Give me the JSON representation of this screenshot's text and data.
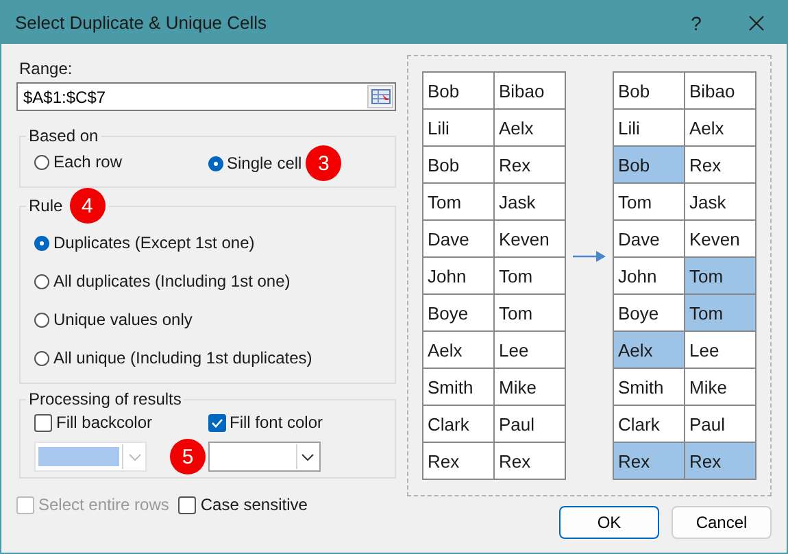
{
  "window": {
    "title": "Select Duplicate & Unique Cells",
    "help": "?"
  },
  "range": {
    "label": "Range:",
    "value": "$A$1:$C$7"
  },
  "based_on": {
    "title": "Based on",
    "badge": "3",
    "options": [
      {
        "label": "Each row",
        "selected": false
      },
      {
        "label": "Single cell",
        "selected": true
      }
    ]
  },
  "rule": {
    "title": "Rule",
    "badge": "4",
    "options": [
      {
        "label": "Duplicates (Except 1st one)",
        "selected": true
      },
      {
        "label": "All duplicates (Including 1st one)",
        "selected": false
      },
      {
        "label": "Unique values only",
        "selected": false
      },
      {
        "label": "All unique (Including 1st duplicates)",
        "selected": false
      }
    ]
  },
  "processing": {
    "title": "Processing of results",
    "badge": "5",
    "options": [
      {
        "label": "Fill backcolor",
        "checked": false,
        "color": "#a8c8f0",
        "disabled": true
      },
      {
        "label": "Fill font color",
        "checked": true,
        "color": "#ffffff",
        "disabled": false
      }
    ]
  },
  "bottom_options": [
    {
      "label": "Select entire rows",
      "checked": false,
      "disabled": true
    },
    {
      "label": "Case sensitive",
      "checked": false,
      "disabled": false
    }
  ],
  "preview": {
    "before": [
      [
        {
          "text": "Bob",
          "highlighted": false
        },
        {
          "text": "Bibao",
          "highlighted": false
        }
      ],
      [
        {
          "text": "Lili",
          "highlighted": false
        },
        {
          "text": "Aelx",
          "highlighted": false
        }
      ],
      [
        {
          "text": "Bob",
          "highlighted": false
        },
        {
          "text": "Rex",
          "highlighted": false
        }
      ],
      [
        {
          "text": "Tom",
          "highlighted": false
        },
        {
          "text": "Jask",
          "highlighted": false
        }
      ],
      [
        {
          "text": "Dave",
          "highlighted": false
        },
        {
          "text": "Keven",
          "highlighted": false
        }
      ],
      [
        {
          "text": "John",
          "highlighted": false
        },
        {
          "text": "Tom",
          "highlighted": false
        }
      ],
      [
        {
          "text": "Boye",
          "highlighted": false
        },
        {
          "text": "Tom",
          "highlighted": false
        }
      ],
      [
        {
          "text": "Aelx",
          "highlighted": false
        },
        {
          "text": "Lee",
          "highlighted": false
        }
      ],
      [
        {
          "text": "Smith",
          "highlighted": false
        },
        {
          "text": "Mike",
          "highlighted": false
        }
      ],
      [
        {
          "text": "Clark",
          "highlighted": false
        },
        {
          "text": "Paul",
          "highlighted": false
        }
      ],
      [
        {
          "text": "Rex",
          "highlighted": false
        },
        {
          "text": "Rex",
          "highlighted": false
        }
      ]
    ],
    "after": [
      [
        {
          "text": "Bob",
          "highlighted": false
        },
        {
          "text": "Bibao",
          "highlighted": false
        }
      ],
      [
        {
          "text": "Lili",
          "highlighted": false
        },
        {
          "text": "Aelx",
          "highlighted": false
        }
      ],
      [
        {
          "text": "Bob",
          "highlighted": true
        },
        {
          "text": "Rex",
          "highlighted": false
        }
      ],
      [
        {
          "text": "Tom",
          "highlighted": false
        },
        {
          "text": "Jask",
          "highlighted": false
        }
      ],
      [
        {
          "text": "Dave",
          "highlighted": false
        },
        {
          "text": "Keven",
          "highlighted": false
        }
      ],
      [
        {
          "text": "John",
          "highlighted": false
        },
        {
          "text": "Tom",
          "highlighted": true
        }
      ],
      [
        {
          "text": "Boye",
          "highlighted": false
        },
        {
          "text": "Tom",
          "highlighted": true
        }
      ],
      [
        {
          "text": "Aelx",
          "highlighted": true
        },
        {
          "text": "Lee",
          "highlighted": false
        }
      ],
      [
        {
          "text": "Smith",
          "highlighted": false
        },
        {
          "text": "Mike",
          "highlighted": false
        }
      ],
      [
        {
          "text": "Clark",
          "highlighted": false
        },
        {
          "text": "Paul",
          "highlighted": false
        }
      ],
      [
        {
          "text": "Rex",
          "highlighted": true
        },
        {
          "text": "Rex",
          "highlighted": true
        }
      ]
    ]
  },
  "buttons": [
    {
      "label": "OK",
      "default": true
    },
    {
      "label": "Cancel",
      "default": false
    }
  ]
}
